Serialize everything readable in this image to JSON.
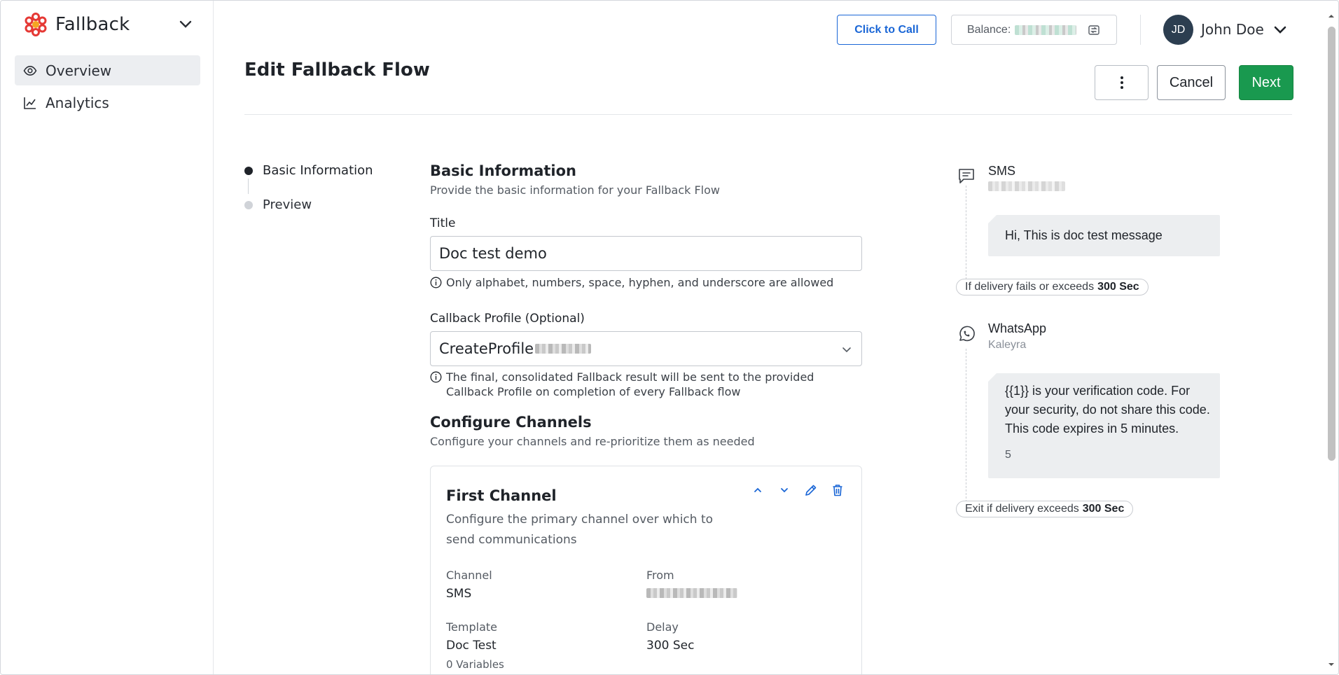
{
  "brand": {
    "name": "Fallback"
  },
  "sidebar": {
    "items": [
      {
        "label": "Overview",
        "icon": "eye-icon",
        "active": true
      },
      {
        "label": "Analytics",
        "icon": "chart-line-icon",
        "active": false
      }
    ]
  },
  "topbar": {
    "call_label": "Click to Call",
    "balance_label": "Balance:",
    "user_initials": "JD",
    "user_name": "John Doe"
  },
  "header": {
    "title": "Edit Fallback Flow",
    "more_icon": "more-vertical-icon",
    "cancel_label": "Cancel",
    "next_label": "Next"
  },
  "stepper": {
    "steps": [
      {
        "label": "Basic Information",
        "active": true
      },
      {
        "label": "Preview",
        "active": false
      }
    ]
  },
  "form": {
    "section_title": "Basic Information",
    "section_sub": "Provide the basic information for your Fallback Flow",
    "title_label": "Title",
    "title_value": "Doc test demo",
    "title_hint": "Only alphabet, numbers, space, hyphen, and underscore are allowed",
    "callback_label": "Callback Profile (Optional)",
    "callback_value": "CreateProfile",
    "callback_hint": "The final, consolidated Fallback result will be sent to the provided Callback Profile on completion of every Fallback flow",
    "channels_title": "Configure Channels",
    "channels_sub": "Configure your channels and re-prioritize them as needed"
  },
  "channel_card": {
    "title": "First Channel",
    "subtitle": "Configure the primary channel over which to send communications",
    "channel_label": "Channel",
    "channel_value": "SMS",
    "from_label": "From",
    "template_label": "Template",
    "template_value": "Doc Test",
    "variables_text": "0 Variables",
    "delay_label": "Delay",
    "delay_value": "300 Sec"
  },
  "preview": {
    "sms_title": "SMS",
    "sms_message": "Hi, This is doc test message",
    "fail_text": "If delivery fails or exceeds",
    "fail_value": "300 Sec",
    "wa_title": "WhatsApp",
    "wa_sub": "Kaleyra",
    "wa_message": "{{1}} is your verification code. For your security, do not share this code. This code expires in 5 minutes.",
    "wa_extra": "5",
    "exit_text": "Exit if delivery exceeds",
    "exit_value": "300 Sec"
  },
  "colors": {
    "accent": "#1a66d6",
    "primary_green": "#19994f",
    "logo_red": "#e53935"
  }
}
